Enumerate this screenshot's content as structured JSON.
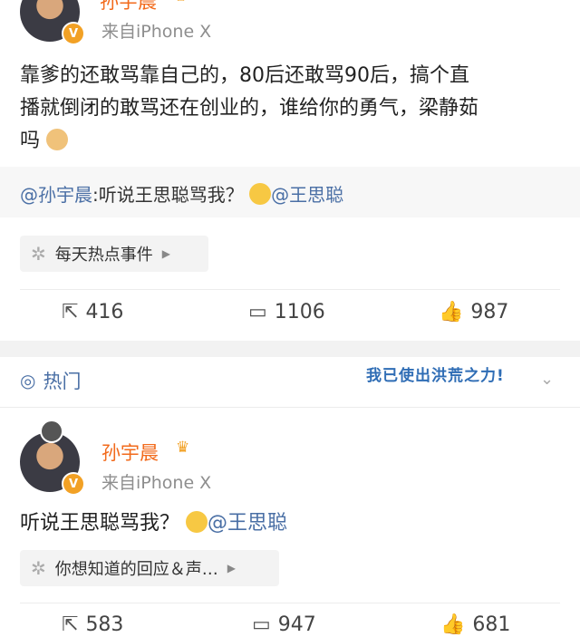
{
  "post1": {
    "username": "孙宇晨",
    "source": "来自iPhone X",
    "body": "靠爹的还敢骂靠自己的，80后还敢骂90后，搞个直播就倒闭的敢骂还在创业的，谁给你的勇气，梁静茹吗",
    "body_line1": "靠爹的还敢骂靠自己的，80后还敢骂90后，搞个直",
    "body_line2": "播就倒闭的敢骂还在创业的，谁给你的勇气，梁静茹",
    "body_line3": "吗",
    "repost": {
      "mention": "@孙宇晨",
      "text": ":听说王思聪骂我？",
      "mention2": "@王思聪"
    },
    "topic": "每天热点事件",
    "reposts": "416",
    "comments": "1106",
    "likes": "987"
  },
  "hot_section": {
    "label": "热门",
    "sticker_text": "我已使出洪荒之力!"
  },
  "post2": {
    "username": "孙宇晨",
    "source": "来自iPhone X",
    "body": "听说王思聪骂我？",
    "mention": "@王思聪",
    "topic": "你想知道的回应＆声…",
    "reposts": "583",
    "comments": "947",
    "likes": "681"
  },
  "colors": {
    "username": "#f26a1b",
    "mention": "#4a6fa5",
    "badge": "#f2a125"
  },
  "icons": [
    "v-verified-icon",
    "crown-icon",
    "doge-emoji-icon",
    "smile-emoji-icon",
    "pinwheel-icon",
    "repost-icon",
    "comment-icon",
    "like-icon",
    "hot-icon",
    "chevron-down-icon",
    "arrow-right-icon"
  ]
}
